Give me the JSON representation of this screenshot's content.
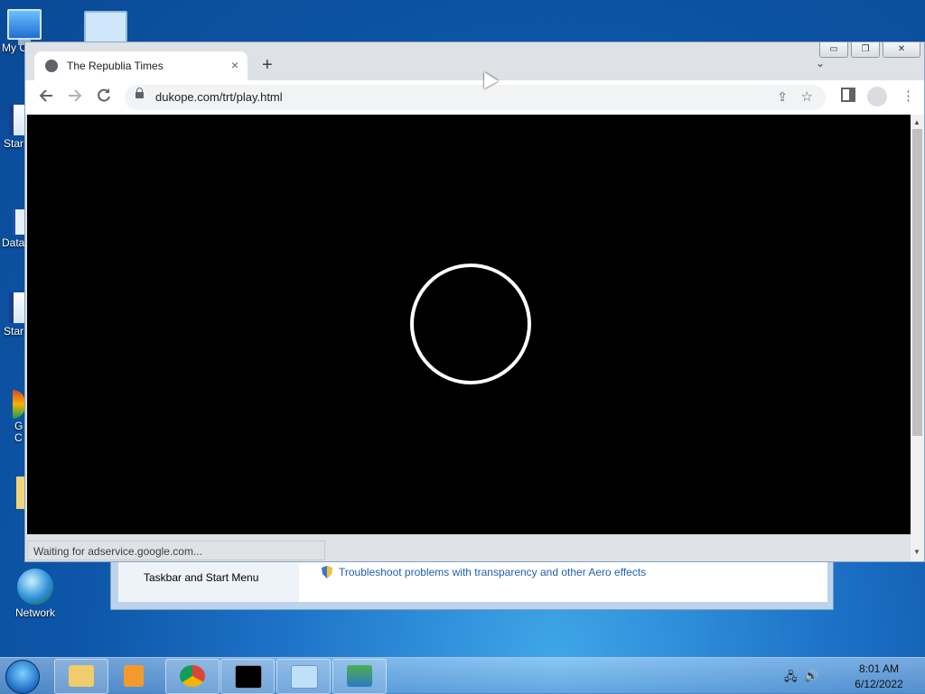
{
  "desktop": {
    "icons": [
      {
        "label": "My C"
      },
      {
        "label": "Star"
      },
      {
        "label": "Data"
      },
      {
        "label": "Star"
      },
      {
        "label": "G\nC"
      },
      {
        "label": "Network"
      }
    ]
  },
  "control_panel": {
    "left_item": "Taskbar and Start Menu",
    "link": "Troubleshoot problems with transparency and other Aero effects"
  },
  "browser": {
    "tab_title": "The Republia Times",
    "tab_close": "×",
    "new_tab": "+",
    "tab_list": "⌄",
    "url": "dukope.com/trt/play.html",
    "status": "Waiting for adservice.google.com...",
    "window_controls": [
      "▭",
      "❐",
      "✕"
    ]
  },
  "taskbar": {
    "time": "8:01 AM",
    "date": "6/12/2022",
    "apps": [
      "file-explorer",
      "media-player",
      "chrome",
      "command-prompt",
      "control-panel",
      "remote-desktop"
    ]
  }
}
